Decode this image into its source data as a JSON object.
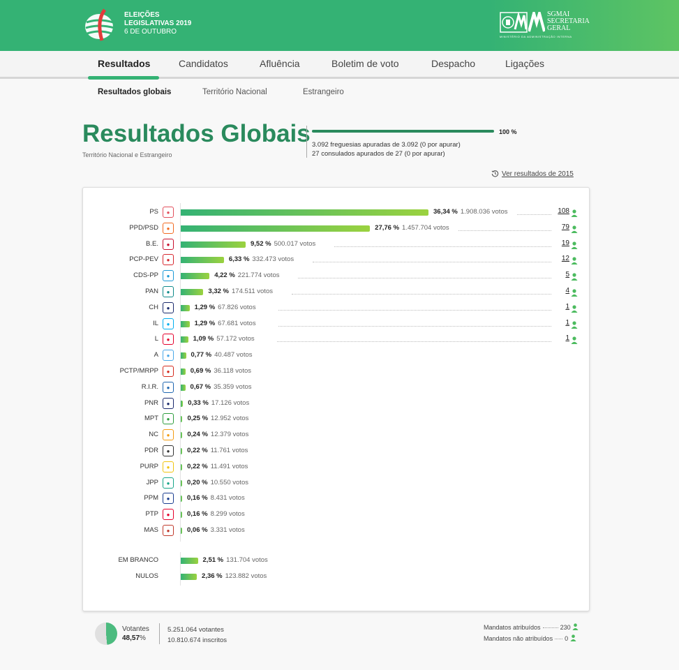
{
  "header": {
    "election_line1": "ELEIÇÕES",
    "election_line2": "LEGISLATIVAS 2019",
    "election_date": "6 DE OUTUBRO",
    "org_line1": "SGMAI",
    "org_line2": "SECRETARIA",
    "org_line3": "GERAL",
    "ministry": "MINISTÉRIO DA ADMINISTRAÇÃO INTERNA",
    "brand_color": "#34b274"
  },
  "nav": {
    "tabs": [
      {
        "label": "Resultados",
        "active": true
      },
      {
        "label": "Candidatos",
        "active": false
      },
      {
        "label": "Afluência",
        "active": false
      },
      {
        "label": "Boletim de voto",
        "active": false
      },
      {
        "label": "Despacho",
        "active": false
      },
      {
        "label": "Ligações",
        "active": false
      }
    ],
    "subtabs": [
      {
        "label": "Resultados globais",
        "active": true
      },
      {
        "label": "Território Nacional",
        "active": false
      },
      {
        "label": "Estrangeiro",
        "active": false
      }
    ]
  },
  "summary": {
    "title": "Resultados Globais",
    "subtitle": "Território Nacional e Estrangeiro",
    "progress_label": "100 %",
    "progress_fraction": 1.0,
    "freguesias": "3.092 freguesias apuradas de 3.092 (0 por apurar)",
    "consulados": "27 consulados apurados de 27 (0 por apurar)",
    "history_link": "Ver resultados de 2015"
  },
  "parties": [
    {
      "name": "PS",
      "pct": "36,34 %",
      "pct_value": 36.34,
      "votes": "1.908.036 votos",
      "seats": "108",
      "icon": "ps-rose-icon",
      "color": "#e24f5c"
    },
    {
      "name": "PPD/PSD",
      "pct": "27,76 %",
      "pct_value": 27.76,
      "votes": "1.457.704 votos",
      "seats": "79",
      "icon": "psd-arrows-icon",
      "color": "#f26a21"
    },
    {
      "name": "B.E.",
      "pct": "9,52 %",
      "pct_value": 9.52,
      "votes": "500.017 votos",
      "seats": "19",
      "icon": "be-star-icon",
      "color": "#c8102e"
    },
    {
      "name": "PCP-PEV",
      "pct": "6,33 %",
      "pct_value": 6.33,
      "votes": "332.473 votos",
      "seats": "12",
      "icon": "cdu-icon",
      "color": "#d7282f"
    },
    {
      "name": "CDS-PP",
      "pct": "4,22 %",
      "pct_value": 4.22,
      "votes": "221.774 votos",
      "seats": "5",
      "icon": "cds-icon",
      "color": "#1c9ad6"
    },
    {
      "name": "PAN",
      "pct": "3,32 %",
      "pct_value": 3.32,
      "votes": "174.511 votos",
      "seats": "4",
      "icon": "pan-tree-icon",
      "color": "#0f8a8a"
    },
    {
      "name": "CH",
      "pct": "1,29 %",
      "pct_value": 1.29,
      "votes": "67.826 votos",
      "seats": "1",
      "icon": "chega-icon",
      "color": "#1a2a6c"
    },
    {
      "name": "IL",
      "pct": "1,29 %",
      "pct_value": 1.29,
      "votes": "67.681 votos",
      "seats": "1",
      "icon": "il-icon",
      "color": "#00aeef"
    },
    {
      "name": "L",
      "pct": "1,09 %",
      "pct_value": 1.09,
      "votes": "57.172 votos",
      "seats": "1",
      "icon": "livre-poppy-icon",
      "color": "#e4002b"
    },
    {
      "name": "A",
      "pct": "0,77 %",
      "pct_value": 0.77,
      "votes": "40.487 votos",
      "seats": "",
      "icon": "alianca-icon",
      "color": "#4aa8e8"
    },
    {
      "name": "PCTP/MRPP",
      "pct": "0,69 %",
      "pct_value": 0.69,
      "votes": "36.118 votos",
      "seats": "",
      "icon": "mrpp-icon",
      "color": "#d52b1e"
    },
    {
      "name": "R.I.R.",
      "pct": "0,67 %",
      "pct_value": 0.67,
      "votes": "35.359 votos",
      "seats": "",
      "icon": "rir-icon",
      "color": "#1e66b0"
    },
    {
      "name": "PNR",
      "pct": "0,33 %",
      "pct_value": 0.33,
      "votes": "17.126 votos",
      "seats": "",
      "icon": "pnr-icon",
      "color": "#1a2a6c"
    },
    {
      "name": "MPT",
      "pct": "0,25 %",
      "pct_value": 0.25,
      "votes": "12.952 votos",
      "seats": "",
      "icon": "mpt-clover-icon",
      "color": "#2e9e3e"
    },
    {
      "name": "NC",
      "pct": "0,24 %",
      "pct_value": 0.24,
      "votes": "12.379 votos",
      "seats": "",
      "icon": "nc-icon",
      "color": "#f39c12"
    },
    {
      "name": "PDR",
      "pct": "0,22 %",
      "pct_value": 0.22,
      "votes": "11.761 votos",
      "seats": "",
      "icon": "pdr-stars-icon",
      "color": "#333333"
    },
    {
      "name": "PURP",
      "pct": "0,22 %",
      "pct_value": 0.22,
      "votes": "11.491 votos",
      "seats": "",
      "icon": "purp-icon",
      "color": "#f1c40f"
    },
    {
      "name": "JPP",
      "pct": "0,20 %",
      "pct_value": 0.2,
      "votes": "10.550 votos",
      "seats": "",
      "icon": "jpp-icon",
      "color": "#17a589"
    },
    {
      "name": "PPM",
      "pct": "0,16 %",
      "pct_value": 0.16,
      "votes": "8.431 votos",
      "seats": "",
      "icon": "ppm-icon",
      "color": "#1a3d8f"
    },
    {
      "name": "PTP",
      "pct": "0,16 %",
      "pct_value": 0.16,
      "votes": "8.299 votos",
      "seats": "",
      "icon": "ptp-icon",
      "color": "#e4002b"
    },
    {
      "name": "MAS",
      "pct": "0,06 %",
      "pct_value": 0.06,
      "votes": "3.331 votos",
      "seats": "",
      "icon": "mas-icon",
      "color": "#c0392b"
    }
  ],
  "others": [
    {
      "name": "EM BRANCO",
      "pct": "2,51 %",
      "pct_value": 2.51,
      "votes": "131.704 votos"
    },
    {
      "name": "NULOS",
      "pct": "2,36 %",
      "pct_value": 2.36,
      "votes": "123.882 votos"
    }
  ],
  "footer": {
    "turnout_label": "Votantes",
    "turnout_pct": "48,57",
    "turnout_pct_sign": "%",
    "turnout_fraction": 0.4857,
    "voters": "5.251.064 votantes",
    "registered": "10.810.674 inscritos",
    "seats_assigned_label": "Mandatos atribuídos",
    "seats_assigned": "230",
    "seats_unassigned_label": "Mandatos não atribuídos",
    "seats_unassigned": "0"
  }
}
